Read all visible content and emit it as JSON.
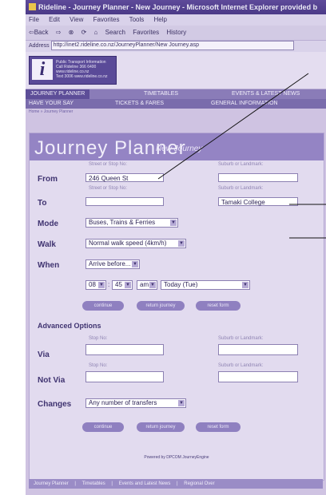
{
  "window": {
    "title": "Rideline - Journey Planner - New Journey - Microsoft Internet Explorer provided b"
  },
  "menu": [
    "File",
    "Edit",
    "View",
    "Favorites",
    "Tools",
    "Help"
  ],
  "toolbar": [
    "⇦Back",
    "⇨",
    "⊗",
    "⟳",
    "⌂",
    "Search",
    "Favorites",
    "History"
  ],
  "address": {
    "label": "Address",
    "value": "http://inet2.rideline.co.nz/JourneyPlanner/New Journey.asp"
  },
  "logo": {
    "glyph": "i",
    "lines": [
      "Public Transport Information",
      "Call Rideline 366 6400",
      "www.rideline.co.nz",
      "Text 3006 www.rideline.co.nz"
    ]
  },
  "nav_top": [
    "JOURNEY PLANNER",
    "TIMETABLES",
    "EVENTS & LATEST NEWS"
  ],
  "nav_bottom": [
    "HAVE YOUR SAY",
    "TICKETS & FARES",
    "GENERAL INFORMATION"
  ],
  "breadcrumb": "Home » Journey Planner",
  "page": {
    "title": "Journey Planner",
    "subtitle": "New Journey"
  },
  "hints": {
    "street": "Street or Stop No:",
    "suburb": "Suburb or Landmark:",
    "stop": "Stop No:"
  },
  "form": {
    "from_label": "From",
    "from_value": "246 Queen St",
    "from_suburb": "",
    "to_label": "To",
    "to_value": "",
    "to_suburb": "Tamaki College",
    "mode_label": "Mode",
    "mode_value": "Buses, Trains & Ferries",
    "walk_label": "Walk",
    "walk_value": "Normal walk speed (4km/h)",
    "when_label": "When",
    "when_value": "Arrive before...",
    "hour": "08",
    "minute": "45",
    "ampm": "am",
    "day": "Today (Tue)"
  },
  "buttons": {
    "continue": "continue",
    "return": "return journey",
    "reset": "reset form"
  },
  "advanced": {
    "title": "Advanced Options",
    "via_label": "Via",
    "via_value": "",
    "via_suburb": "",
    "notvia_label": "Not Via",
    "notvia_value": "",
    "notvia_suburb": "",
    "changes_label": "Changes",
    "changes_value": "Any number of transfers"
  },
  "powered": "Powered by DPCOM JourneyEngine",
  "footer": [
    "Journey Planner",
    "|",
    "Timetables",
    "|",
    "Events and Latest News",
    "|",
    "Regional Over"
  ],
  "colors": {
    "accent": "#9484c4",
    "panel": "#e2dbef",
    "label": "#3f3370"
  }
}
